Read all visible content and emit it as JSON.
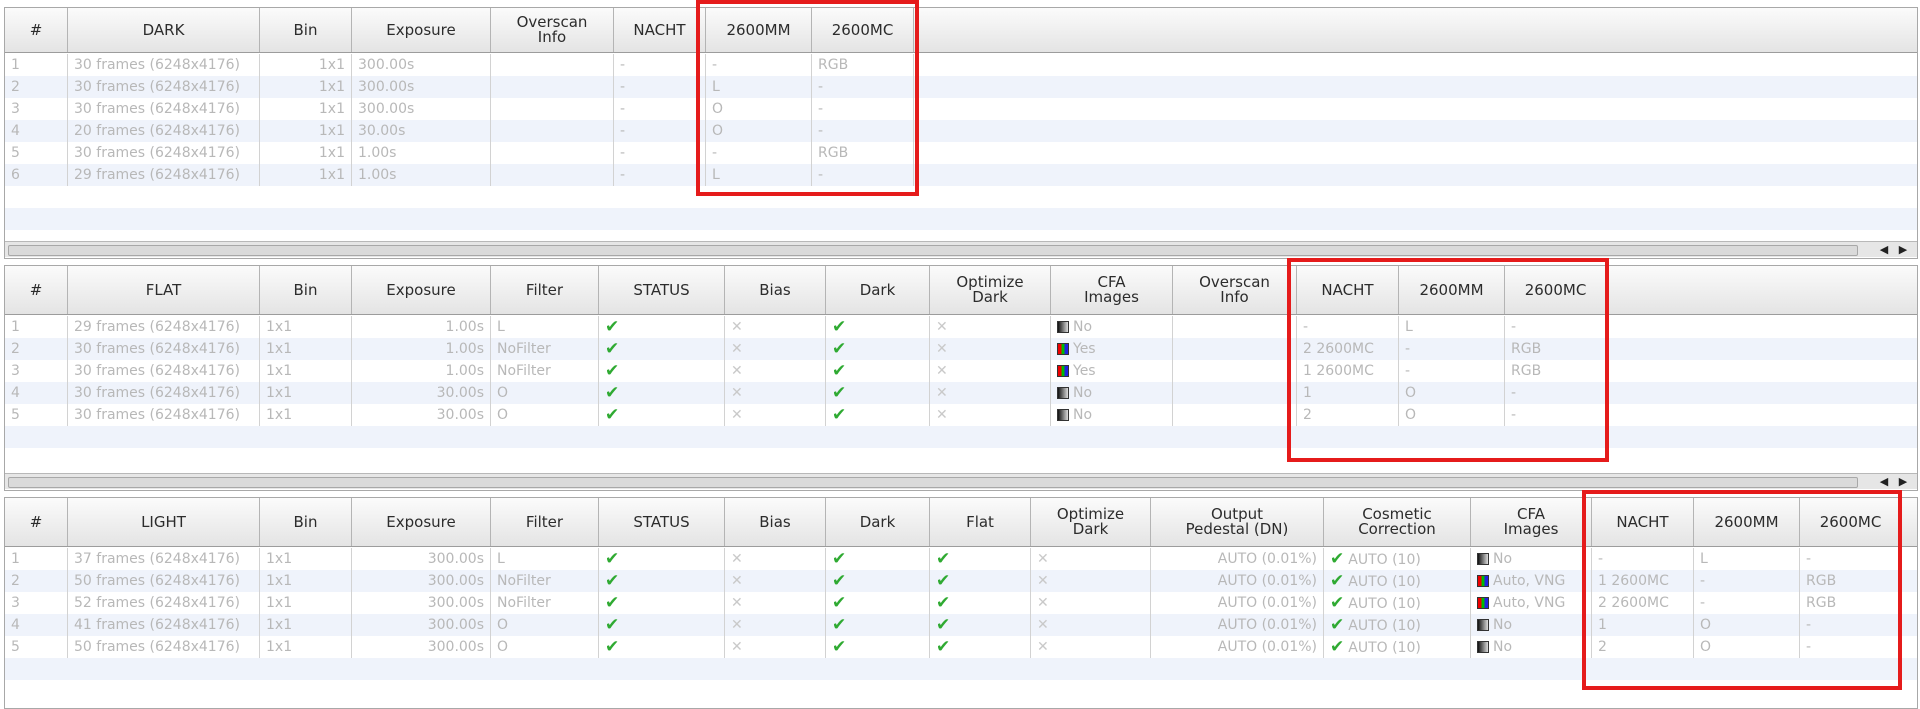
{
  "dark": {
    "columns": [
      "#",
      "DARK",
      "Bin",
      "Exposure",
      "Overscan\nInfo",
      "NACHT",
      "2600MM",
      "2600MC"
    ],
    "rows": [
      {
        "n": "1",
        "frames": "30 frames (6248x4176)",
        "bin": "1x1",
        "exposure": "300.00s",
        "overscan": "",
        "nacht": "-",
        "mm": "-",
        "mc": "RGB"
      },
      {
        "n": "2",
        "frames": "30 frames (6248x4176)",
        "bin": "1x1",
        "exposure": "300.00s",
        "overscan": "",
        "nacht": "-",
        "mm": "L",
        "mc": "-"
      },
      {
        "n": "3",
        "frames": "30 frames (6248x4176)",
        "bin": "1x1",
        "exposure": "300.00s",
        "overscan": "",
        "nacht": "-",
        "mm": "O",
        "mc": "-"
      },
      {
        "n": "4",
        "frames": "20 frames (6248x4176)",
        "bin": "1x1",
        "exposure": "30.00s",
        "overscan": "",
        "nacht": "-",
        "mm": "O",
        "mc": "-"
      },
      {
        "n": "5",
        "frames": "30 frames (6248x4176)",
        "bin": "1x1",
        "exposure": "1.00s",
        "overscan": "",
        "nacht": "-",
        "mm": "-",
        "mc": "RGB"
      },
      {
        "n": "6",
        "frames": "29 frames (6248x4176)",
        "bin": "1x1",
        "exposure": "1.00s",
        "overscan": "",
        "nacht": "-",
        "mm": "L",
        "mc": "-"
      }
    ]
  },
  "flat": {
    "columns": [
      "#",
      "FLAT",
      "Bin",
      "Exposure",
      "Filter",
      "STATUS",
      "Bias",
      "Dark",
      "Optimize\nDark",
      "CFA\nImages",
      "Overscan\nInfo",
      "NACHT",
      "2600MM",
      "2600MC"
    ],
    "rows": [
      {
        "n": "1",
        "frames": "29 frames (6248x4176)",
        "bin": "1x1",
        "exposure": "1.00s",
        "filter": "L",
        "status": "check",
        "bias": "x",
        "dark": "check",
        "optimize": "x",
        "cfa_icon": "mono",
        "cfa": "No",
        "overscan": "",
        "nacht": "-",
        "mm": "L",
        "mc": "-"
      },
      {
        "n": "2",
        "frames": "30 frames (6248x4176)",
        "bin": "1x1",
        "exposure": "1.00s",
        "filter": "NoFilter",
        "status": "check",
        "bias": "x",
        "dark": "check",
        "optimize": "x",
        "cfa_icon": "color",
        "cfa": "Yes",
        "overscan": "",
        "nacht": "2 2600MC",
        "mm": "-",
        "mc": "RGB"
      },
      {
        "n": "3",
        "frames": "30 frames (6248x4176)",
        "bin": "1x1",
        "exposure": "1.00s",
        "filter": "NoFilter",
        "status": "check",
        "bias": "x",
        "dark": "check",
        "optimize": "x",
        "cfa_icon": "color",
        "cfa": "Yes",
        "overscan": "",
        "nacht": "1 2600MC",
        "mm": "-",
        "mc": "RGB"
      },
      {
        "n": "4",
        "frames": "30 frames (6248x4176)",
        "bin": "1x1",
        "exposure": "30.00s",
        "filter": "O",
        "status": "check",
        "bias": "x",
        "dark": "check",
        "optimize": "x",
        "cfa_icon": "mono",
        "cfa": "No",
        "overscan": "",
        "nacht": "1",
        "mm": "O",
        "mc": "-"
      },
      {
        "n": "5",
        "frames": "30 frames (6248x4176)",
        "bin": "1x1",
        "exposure": "30.00s",
        "filter": "O",
        "status": "check",
        "bias": "x",
        "dark": "check",
        "optimize": "x",
        "cfa_icon": "mono",
        "cfa": "No",
        "overscan": "",
        "nacht": "2",
        "mm": "O",
        "mc": "-"
      }
    ]
  },
  "light": {
    "columns": [
      "#",
      "LIGHT",
      "Bin",
      "Exposure",
      "Filter",
      "STATUS",
      "Bias",
      "Dark",
      "Flat",
      "Optimize\nDark",
      "Output\nPedestal (DN)",
      "Cosmetic\nCorrection",
      "CFA\nImages",
      "NACHT",
      "2600MM",
      "2600MC"
    ],
    "rows": [
      {
        "n": "1",
        "frames": "37 frames (6248x4176)",
        "bin": "1x1",
        "exposure": "300.00s",
        "filter": "L",
        "status": "check",
        "bias": "x",
        "dark": "check",
        "flat": "check",
        "optimize": "x",
        "pedestal": "AUTO (0.01%)",
        "cosmetic": "AUTO (10)",
        "cfa_icon": "mono",
        "cfa": "No",
        "nacht": "-",
        "mm": "L",
        "mc": "-"
      },
      {
        "n": "2",
        "frames": "50 frames (6248x4176)",
        "bin": "1x1",
        "exposure": "300.00s",
        "filter": "NoFilter",
        "status": "check",
        "bias": "x",
        "dark": "check",
        "flat": "check",
        "optimize": "x",
        "pedestal": "AUTO (0.01%)",
        "cosmetic": "AUTO (10)",
        "cfa_icon": "color",
        "cfa": "Auto, VNG",
        "nacht": "1 2600MC",
        "mm": "-",
        "mc": "RGB"
      },
      {
        "n": "3",
        "frames": "52 frames (6248x4176)",
        "bin": "1x1",
        "exposure": "300.00s",
        "filter": "NoFilter",
        "status": "check",
        "bias": "x",
        "dark": "check",
        "flat": "check",
        "optimize": "x",
        "pedestal": "AUTO (0.01%)",
        "cosmetic": "AUTO (10)",
        "cfa_icon": "color",
        "cfa": "Auto, VNG",
        "nacht": "2 2600MC",
        "mm": "-",
        "mc": "RGB"
      },
      {
        "n": "4",
        "frames": "41 frames (6248x4176)",
        "bin": "1x1",
        "exposure": "300.00s",
        "filter": "O",
        "status": "check",
        "bias": "x",
        "dark": "check",
        "flat": "check",
        "optimize": "x",
        "pedestal": "AUTO (0.01%)",
        "cosmetic": "AUTO (10)",
        "cfa_icon": "mono",
        "cfa": "No",
        "nacht": "1",
        "mm": "O",
        "mc": "-"
      },
      {
        "n": "5",
        "frames": "50 frames (6248x4176)",
        "bin": "1x1",
        "exposure": "300.00s",
        "filter": "O",
        "status": "check",
        "bias": "x",
        "dark": "check",
        "flat": "check",
        "optimize": "x",
        "pedestal": "AUTO (0.01%)",
        "cosmetic": "AUTO (10)",
        "cfa_icon": "mono",
        "cfa": "No",
        "nacht": "2",
        "mm": "O",
        "mc": "-"
      }
    ]
  },
  "glyphs": {
    "check": "✔",
    "cross": "✕",
    "scroll_left": "◀",
    "scroll_right": "▶"
  },
  "colors": {
    "highlight": "#e51b1b",
    "check": "#2faa32",
    "alt_row": "#eff3fb"
  }
}
